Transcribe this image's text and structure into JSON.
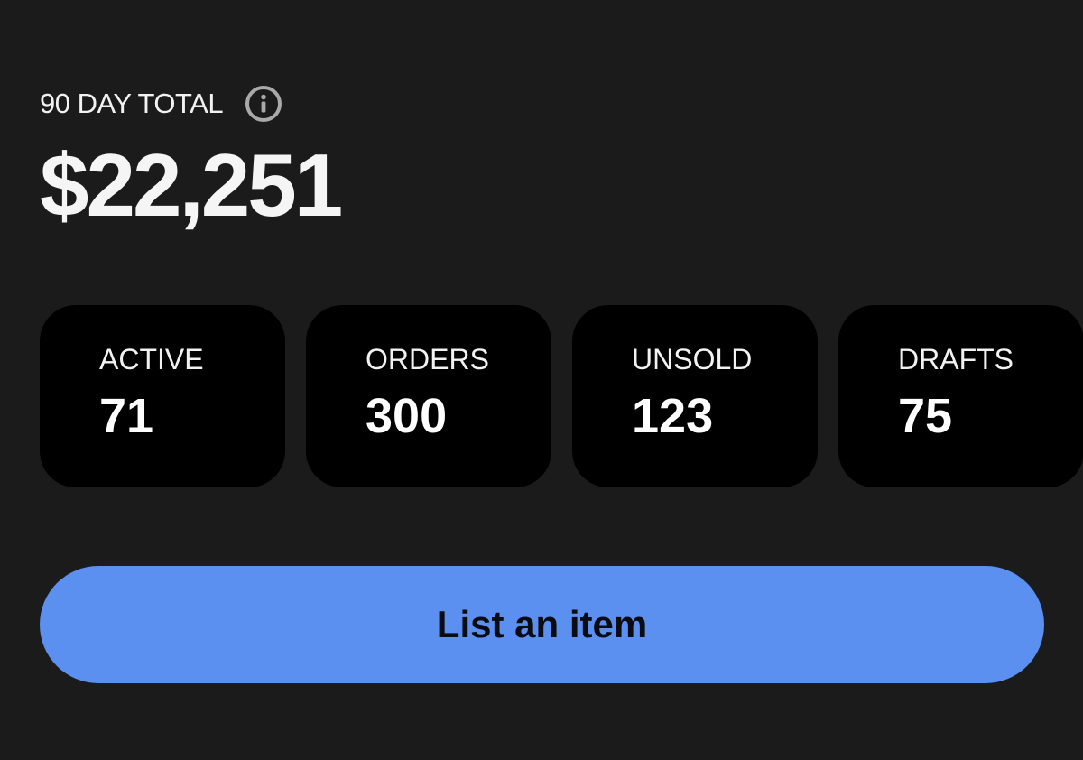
{
  "summary": {
    "period_label": "90 DAY TOTAL",
    "info_icon": "info-icon",
    "total_value": "$22,251"
  },
  "stats": [
    {
      "label": "ACTIVE",
      "value": "71"
    },
    {
      "label": "ORDERS",
      "value": "300"
    },
    {
      "label": "UNSOLD",
      "value": "123"
    },
    {
      "label": "DRAFTS",
      "value": "75"
    }
  ],
  "actions": {
    "list_item_label": "List an item"
  },
  "colors": {
    "background": "#1b1b1c",
    "card_background": "#000000",
    "accent": "#5b8ff0",
    "text_primary": "#f2f2f2",
    "button_text": "#0b0b12"
  }
}
